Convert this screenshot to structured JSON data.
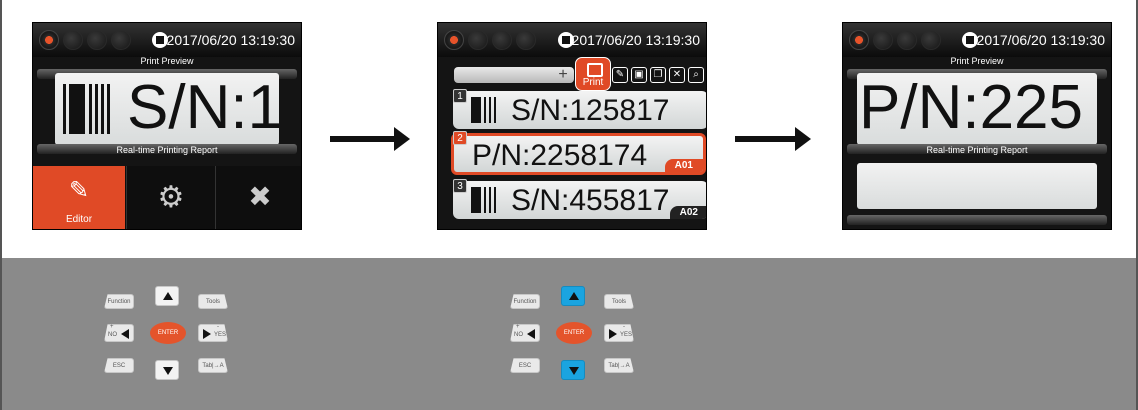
{
  "colors": {
    "accent": "#e04a26",
    "highlight_key": "#1aa4e0",
    "enter_key": "#e4542b",
    "panel_gray": "#8a8a8a"
  },
  "screen1": {
    "timestamp": "2017/06/20 13:19:30",
    "preview_label": "Print Preview",
    "preview_text": "S/N:1",
    "report_label": "Real-time Printing Report",
    "nav": {
      "editor_label": "Editor",
      "settings_icon": "gear-icon",
      "tools_icon": "tools-icon"
    }
  },
  "screen2": {
    "timestamp": "2017/06/20 13:19:30",
    "print_label": "Print",
    "tool_icons": [
      "edit-icon",
      "copy-icon",
      "paste-icon",
      "delete-icon",
      "search-icon"
    ],
    "items": [
      {
        "num": "1",
        "text": "S/N:125817",
        "tag": ""
      },
      {
        "num": "2",
        "text": "P/N:2258174",
        "tag": "A01"
      },
      {
        "num": "3",
        "text": "S/N:455817",
        "tag": "A02"
      }
    ]
  },
  "screen3": {
    "timestamp": "2017/06/20 13:19:30",
    "preview_label": "Print Preview",
    "preview_text": "P/N:225",
    "report_label": "Real-time Printing Report"
  },
  "keypad": {
    "function": "Function",
    "tools": "Tools",
    "no_plus": "+",
    "no": "NO",
    "enter": "ENTER",
    "yes_minus": "-",
    "yes": "YES",
    "esc": "ESC",
    "tab": "Tab|→A"
  }
}
